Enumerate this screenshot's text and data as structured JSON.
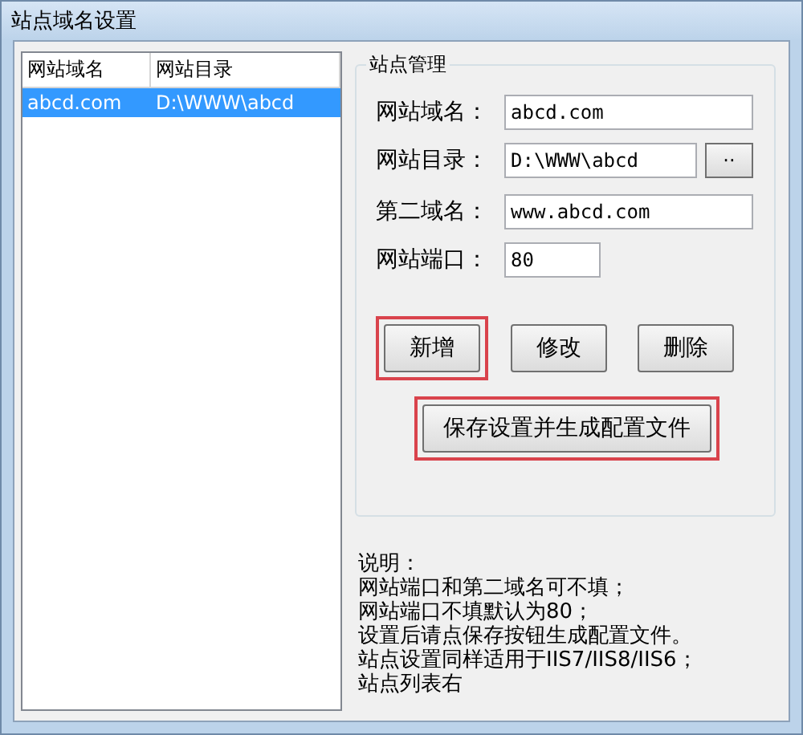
{
  "window": {
    "title": "站点域名设置"
  },
  "site_list": {
    "columns": [
      "网站域名",
      "网站目录"
    ],
    "rows": [
      {
        "cells": [
          "abcd.com",
          "D:\\WWW\\abcd"
        ],
        "selected": true
      }
    ]
  },
  "site_management": {
    "title": "站点管理",
    "fields": [
      {
        "label": "网站域名：",
        "value": "abcd.com",
        "kind": "wide"
      },
      {
        "label": "网站目录：",
        "value": "D:\\WWW\\abcd",
        "kind": "browse",
        "button": "··"
      },
      {
        "label": "第二域名：",
        "value": "www.abcd.com",
        "kind": "wide"
      },
      {
        "label": "网站端口：",
        "value": "80",
        "kind": "short"
      }
    ],
    "buttons": [
      {
        "label": "新增",
        "highlighted": true
      },
      {
        "label": "修改",
        "highlighted": false
      },
      {
        "label": "删除",
        "highlighted": false
      }
    ],
    "save_button": {
      "label": "保存设置并生成配置文件",
      "highlighted": true
    }
  },
  "notes": [
    "说明：",
    "网站端口和第二域名可不填；",
    "网站端口不填默认为80；",
    "设置后请点保存按钮生成配置文件。",
    "站点设置同样适用于IIS7/IIS8/IIS6；",
    "站点列表右"
  ]
}
